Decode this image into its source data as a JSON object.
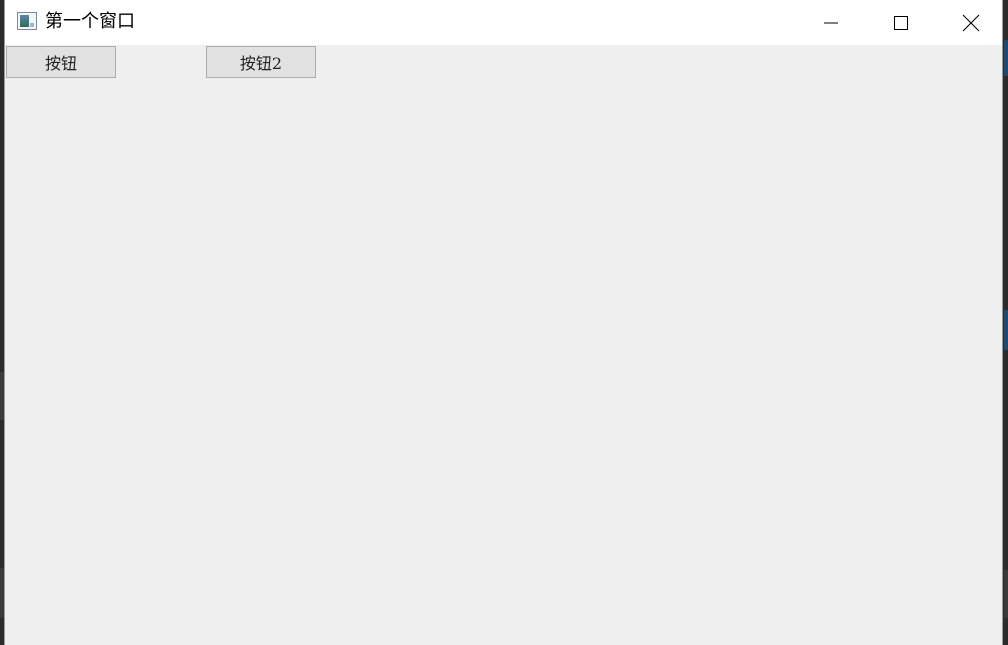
{
  "window": {
    "title": "第一个窗口",
    "icon": "app-window-icon"
  },
  "titlebar": {
    "minimize_icon": "minimize-icon",
    "maximize_icon": "maximize-icon",
    "close_icon": "close-icon"
  },
  "buttons": [
    {
      "label": "按钮"
    },
    {
      "label": "按钮2"
    }
  ],
  "colors": {
    "titlebar_bg": "#ffffff",
    "client_bg": "#efefef",
    "button_bg": "#e1e1e1",
    "button_border": "#adadad"
  }
}
